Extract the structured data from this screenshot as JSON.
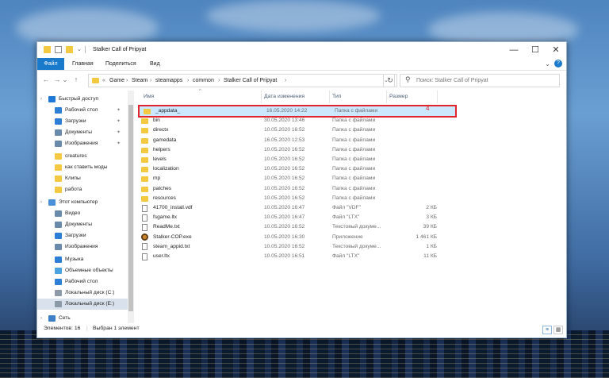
{
  "window": {
    "title": "Stalker Call of Pripyat",
    "min_label": "—",
    "max_label": "☐",
    "close_label": "✕"
  },
  "ribbon": {
    "tabs": [
      "Файл",
      "Главная",
      "Поделиться",
      "Вид"
    ],
    "expand_icon": "chevron-down-icon",
    "help_label": "?"
  },
  "address": {
    "back": "←",
    "forward": "→",
    "recent": "⌄",
    "up": "↑",
    "prefix": "«",
    "crumbs": [
      "Game",
      "Steam",
      "steamapps",
      "common",
      "Stalker Call of Pripyat"
    ],
    "dropdown": "⌄",
    "refresh": "↻"
  },
  "search": {
    "placeholder": "Поиск: Stalker Call of Pripyat"
  },
  "nav": {
    "items": [
      {
        "label": "Быстрый доступ",
        "icon": "star-icon",
        "color": "#1e78d6",
        "indent": 0,
        "pinned": false
      },
      {
        "label": "Рабочий стол",
        "icon": "desktop-icon",
        "color": "#2d7fd6",
        "indent": 1,
        "pinned": true
      },
      {
        "label": "Загрузки",
        "icon": "download-icon",
        "color": "#2d7fd6",
        "indent": 1,
        "pinned": true
      },
      {
        "label": "Документы",
        "icon": "documents-icon",
        "color": "#6a8aab",
        "indent": 1,
        "pinned": true
      },
      {
        "label": "Изображения",
        "icon": "pictures-icon",
        "color": "#6a8aab",
        "indent": 1,
        "pinned": true
      },
      {
        "label": "creatures",
        "icon": "folder-icon",
        "color": "#f4c942",
        "indent": 1,
        "pinned": false
      },
      {
        "label": "как ставить моды",
        "icon": "folder-icon",
        "color": "#f4c942",
        "indent": 1,
        "pinned": false
      },
      {
        "label": "Клипы",
        "icon": "folder-icon",
        "color": "#f4c942",
        "indent": 1,
        "pinned": false
      },
      {
        "label": "работа",
        "icon": "folder-icon",
        "color": "#f4c942",
        "indent": 1,
        "pinned": false
      },
      {
        "label": "Этот компьютер",
        "icon": "computer-icon",
        "color": "#4a90d9",
        "indent": 0,
        "pinned": false
      },
      {
        "label": "Видео",
        "icon": "video-icon",
        "color": "#6a8aab",
        "indent": 1,
        "pinned": false
      },
      {
        "label": "Документы",
        "icon": "documents-icon",
        "color": "#6a8aab",
        "indent": 1,
        "pinned": false
      },
      {
        "label": "Загрузки",
        "icon": "download-icon",
        "color": "#2d7fd6",
        "indent": 1,
        "pinned": false
      },
      {
        "label": "Изображения",
        "icon": "pictures-icon",
        "color": "#6a8aab",
        "indent": 1,
        "pinned": false
      },
      {
        "label": "Музыка",
        "icon": "music-icon",
        "color": "#2d7fd6",
        "indent": 1,
        "pinned": false
      },
      {
        "label": "Объемные объекты",
        "icon": "3d-objects-icon",
        "color": "#4aa3df",
        "indent": 1,
        "pinned": false
      },
      {
        "label": "Рабочий стол",
        "icon": "desktop-icon",
        "color": "#2d7fd6",
        "indent": 1,
        "pinned": false
      },
      {
        "label": "Локальный диск (C:)",
        "icon": "drive-icon",
        "color": "#8c9aa8",
        "indent": 1,
        "pinned": false
      },
      {
        "label": "Локальный диск (E:)",
        "icon": "drive-icon",
        "color": "#8c9aa8",
        "indent": 1,
        "pinned": false
      },
      {
        "label": "Сеть",
        "icon": "network-icon",
        "color": "#3f7fc7",
        "indent": 0,
        "pinned": false
      }
    ],
    "selected_index": 18,
    "pin_glyph": "📌"
  },
  "columns": {
    "name": "Имя",
    "date": "Дата изменения",
    "type": "Тип",
    "size": "Размер",
    "sort_glyph": "^"
  },
  "files": [
    {
      "name": "_appdata_",
      "date": "16.05.2020 14:22",
      "type": "Папка с файлами",
      "size": "",
      "kind": "folder"
    },
    {
      "name": "bin",
      "date": "30.05.2020 13:46",
      "type": "Папка с файлами",
      "size": "",
      "kind": "folder"
    },
    {
      "name": "directx",
      "date": "10.05.2020 16:52",
      "type": "Папка с файлами",
      "size": "",
      "kind": "folder"
    },
    {
      "name": "gamedata",
      "date": "16.05.2020 12:53",
      "type": "Папка с файлами",
      "size": "",
      "kind": "folder"
    },
    {
      "name": "helpers",
      "date": "10.05.2020 16:52",
      "type": "Папка с файлами",
      "size": "",
      "kind": "folder"
    },
    {
      "name": "levels",
      "date": "10.05.2020 16:52",
      "type": "Папка с файлами",
      "size": "",
      "kind": "folder"
    },
    {
      "name": "localization",
      "date": "10.05.2020 16:52",
      "type": "Папка с файлами",
      "size": "",
      "kind": "folder"
    },
    {
      "name": "mp",
      "date": "10.05.2020 16:52",
      "type": "Папка с файлами",
      "size": "",
      "kind": "folder"
    },
    {
      "name": "patches",
      "date": "10.05.2020 16:52",
      "type": "Папка с файлами",
      "size": "",
      "kind": "folder"
    },
    {
      "name": "resources",
      "date": "10.05.2020 16:52",
      "type": "Папка с файлами",
      "size": "",
      "kind": "folder"
    },
    {
      "name": "41700_install.vdf",
      "date": "10.05.2020 16:47",
      "type": "Файл \"VDF\"",
      "size": "2 КБ",
      "kind": "file"
    },
    {
      "name": "fsgame.ltx",
      "date": "10.05.2020 16:47",
      "type": "Файл \"LTX\"",
      "size": "3 КБ",
      "kind": "file"
    },
    {
      "name": "ReadMe.txt",
      "date": "10.05.2020 16:52",
      "type": "Текстовый докуме...",
      "size": "39 КБ",
      "kind": "file"
    },
    {
      "name": "Stalker-COP.exe",
      "date": "10.05.2020 16:30",
      "type": "Приложение",
      "size": "1 461 КБ",
      "kind": "exe"
    },
    {
      "name": "steam_appid.txt",
      "date": "10.05.2020 16:52",
      "type": "Текстовый докуме...",
      "size": "1 КБ",
      "kind": "file"
    },
    {
      "name": "user.ltx",
      "date": "10.05.2020 16:51",
      "type": "Файл \"LTX\"",
      "size": "11 КБ",
      "kind": "file"
    }
  ],
  "selected_file_index": 0,
  "annotation": "4",
  "status": {
    "count": "Элементов: 16",
    "selected": "Выбран 1 элемент"
  },
  "colors": {
    "accent": "#1979ca",
    "selection": "#cce8ff",
    "highlight_border": "#e0242b",
    "folder": "#f4c942"
  }
}
